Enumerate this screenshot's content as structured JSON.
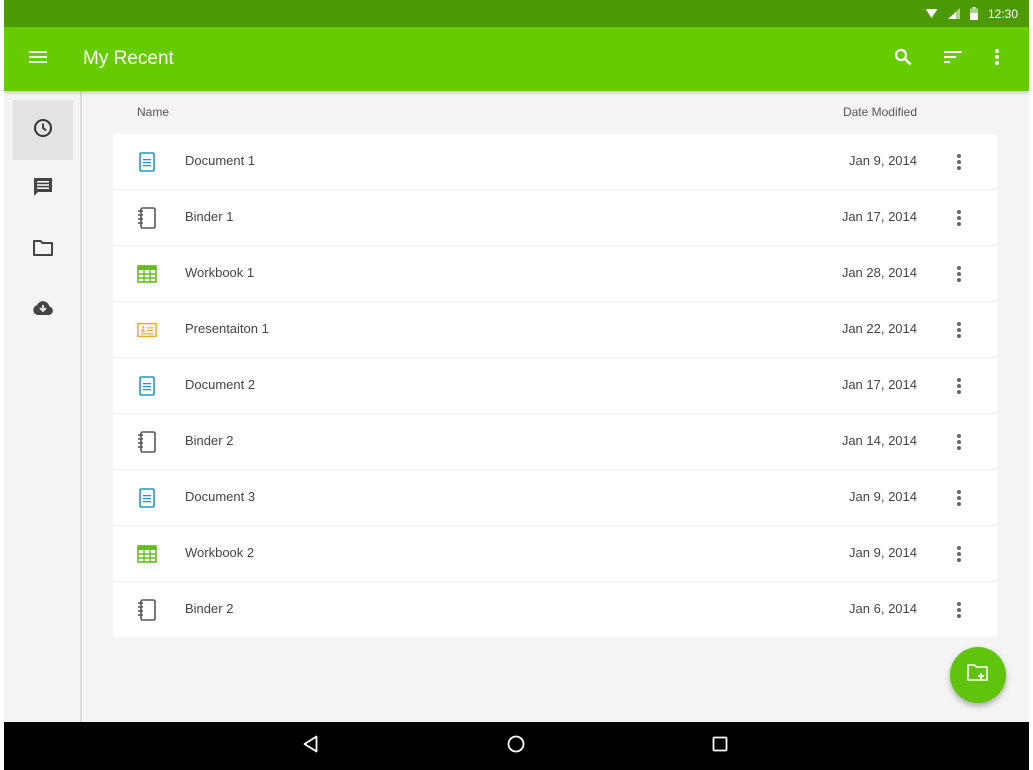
{
  "status_bar": {
    "time": "12:30",
    "icons": [
      "wifi-icon",
      "signal-icon",
      "battery-icon"
    ]
  },
  "app_bar": {
    "title": "My Recent",
    "color": "#66cc00",
    "actions": [
      "search-icon",
      "sort-icon",
      "more-vert-icon"
    ]
  },
  "sidebar": {
    "items": [
      {
        "icon": "recent-clock-icon",
        "active": true
      },
      {
        "icon": "comments-icon",
        "active": false
      },
      {
        "icon": "folder-icon",
        "active": false
      },
      {
        "icon": "cloud-download-icon",
        "active": false
      }
    ]
  },
  "list": {
    "headers": {
      "name": "Name",
      "date": "Date Modified"
    },
    "rows": [
      {
        "type": "document",
        "name": "Document 1",
        "date": "Jan 9, 2014"
      },
      {
        "type": "binder",
        "name": "Binder 1",
        "date": "Jan 17, 2014"
      },
      {
        "type": "workbook",
        "name": "Workbook 1",
        "date": "Jan 28, 2014"
      },
      {
        "type": "presentation",
        "name": "Presentaiton 1",
        "date": "Jan 22, 2014"
      },
      {
        "type": "document",
        "name": "Document 2",
        "date": "Jan 17, 2014"
      },
      {
        "type": "binder",
        "name": "Binder 2",
        "date": "Jan 14, 2014"
      },
      {
        "type": "document",
        "name": "Document 3",
        "date": "Jan 9, 2014"
      },
      {
        "type": "workbook",
        "name": "Workbook 2",
        "date": "Jan 9, 2014"
      },
      {
        "type": "binder",
        "name": "Binder 2",
        "date": "Jan 6, 2014"
      }
    ]
  },
  "fab": {
    "icon": "new-folder-icon",
    "color": "#5fc40b"
  },
  "nav_bar": {
    "buttons": [
      "back-icon",
      "home-icon",
      "recents-icon"
    ]
  },
  "colors": {
    "document": "#2196d3",
    "binder": "#555555",
    "workbook": "#66bb22",
    "presentation": "#f2a91c"
  }
}
